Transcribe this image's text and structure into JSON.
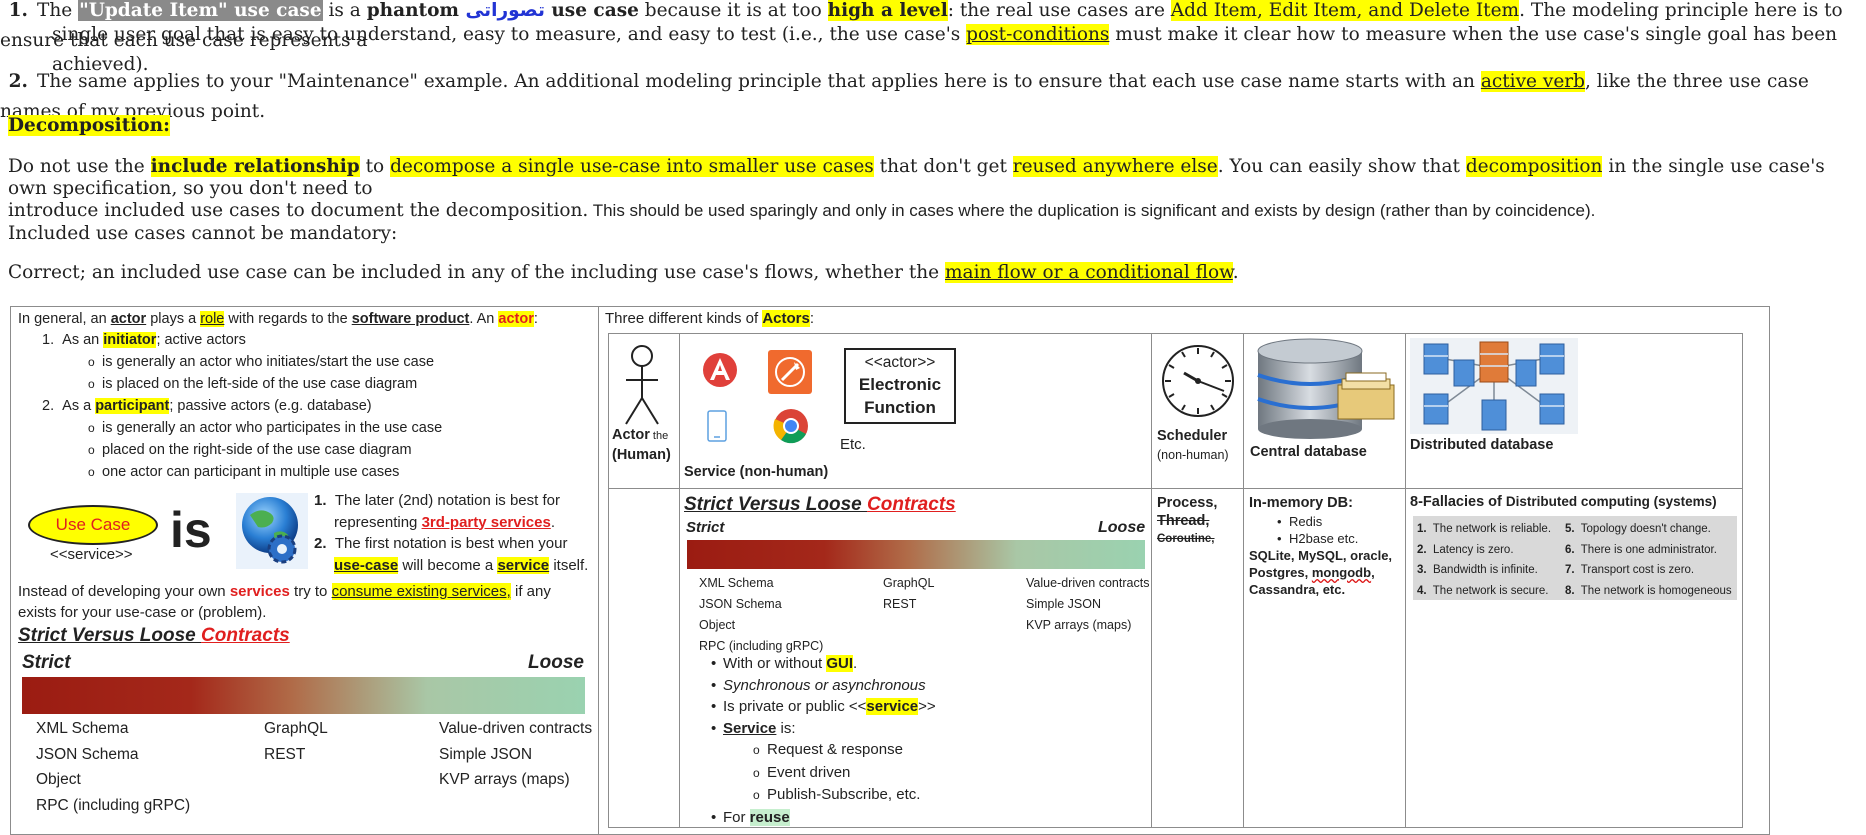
{
  "top": {
    "p1": {
      "num": "1.",
      "a": "The ",
      "b": "\"Update Item\" use case",
      "c": " is a ",
      "d": "phantom",
      "e": " تصوراتی ",
      "f": "use case",
      "g": " because it is at too ",
      "h": "high a level",
      "i": ": the real use cases are ",
      "j": "Add Item, Edit Item, and Delete Item",
      "k": ". The modeling principle here is to ensure that each use case represents a",
      "l": "single user goal that is easy to understand, easy to measure, and easy to test (i.e., the use case's ",
      "m": "post-conditions",
      "n": " must make it clear how to measure when the use case's single goal has been achieved)."
    },
    "p2": {
      "num": "2.",
      "a": "The same applies to your \"Maintenance\" example. An additional modeling principle that applies here is to ensure that each use case name starts with an ",
      "b": "active verb",
      "c": ", like the three use case names of my previous point."
    },
    "decomp_heading": "Decomposition:",
    "p3": {
      "a": "Do not use the ",
      "b": "include relationship",
      "c": " to ",
      "d": "decompose a single use-case into smaller use cases",
      "e": " that don't get ",
      "f": "reused anywhere else",
      "g": ". You can easily show that ",
      "h": "decomposition",
      "i": " in the single use case's own specification, so you don't need to",
      "j": "introduce included use cases to document the decomposition.",
      "k": " This should be used sparingly and only in cases where the duplication is significant and exists by design (rather than by coincidence)."
    },
    "p4": "Included use cases cannot be mandatory:",
    "p5": {
      "a": "Correct; an included use case can be included in any of the including use case's flows, whether the ",
      "b": "main flow or a conditional flow",
      "c": "."
    }
  },
  "left": {
    "intro": {
      "a": "In general, an ",
      "b": "actor",
      "c": " plays a ",
      "d": "role",
      "e": " with regards to the ",
      "f": "software product",
      "g": ". An ",
      "h": "actor",
      "i": ":"
    },
    "l1": {
      "num": "1.",
      "a": "As an ",
      "b": "initiator",
      "c": "; active actors"
    },
    "l1a": "is generally an actor who initiates/start the use case",
    "l1b": "is placed on the left-side of the use case diagram",
    "l2": {
      "num": "2.",
      "a": "As a ",
      "b": "participant",
      "c": "; passive actors (e.g. database)"
    },
    "l2a": "is generally an actor who participates in the use case",
    "l2b": "placed on the right-side of the use case diagram",
    "l2c": "one actor can participant in multiple use cases",
    "usecase_label": "Use Case",
    "service_label": "<<service>>",
    "is_label": "is",
    "n1": {
      "num": "1.",
      "a": "The later (2nd) notation is best for",
      "b": "representing ",
      "c": "3rd-party services",
      "d": "."
    },
    "n2": {
      "num": "2.",
      "a": "The first notation is best when your",
      "b": "use-case",
      "c": " will become a ",
      "d": "service",
      "e": " itself."
    },
    "instead": {
      "a": "Instead of developing your own ",
      "b": "services",
      "c": " try to ",
      "d": "consume existing services,",
      "e": " if any",
      "f": "exists for your use-case or (problem)."
    },
    "svl": {
      "a": "Strict Versus Loose ",
      "b": "Contracts"
    },
    "strict": "Strict",
    "loose": "Loose",
    "col1": [
      "XML Schema",
      "JSON Schema",
      "Object",
      "RPC (including gRPC)"
    ],
    "col2": [
      "GraphQL",
      "REST"
    ],
    "col3": [
      "Value-driven contracts",
      "Simple JSON",
      "KVP arrays (maps)"
    ]
  },
  "right": {
    "heading": {
      "a": "Three different kinds of ",
      "b": "Actors",
      "c": ":"
    },
    "actor_human": {
      "a": "Actor",
      "b": " the",
      "c": "(Human)"
    },
    "electronic": {
      "a": "<<actor>>",
      "b": "Electronic",
      "c": "Function"
    },
    "etc": "Etc.",
    "service_nonhuman": "Service (non-human)",
    "scheduler": {
      "a": "Scheduler",
      "b": "(non-human)"
    },
    "central_db": "Central database",
    "distributed_db": "Distributed database",
    "svl": {
      "a": "Strict Versus Loose ",
      "b": "Contracts"
    },
    "strict": "Strict",
    "loose": "Loose",
    "col1": [
      "XML Schema",
      "JSON Schema",
      "Object",
      "RPC (including gRPC)"
    ],
    "col2": [
      "GraphQL",
      "REST"
    ],
    "col3": [
      "Value-driven contracts",
      "Simple JSON",
      "KVP arrays (maps)"
    ],
    "b1": {
      "a": "With or without ",
      "b": "GUI",
      "c": "."
    },
    "b2": "Synchronous or asynchronous",
    "b3": {
      "a": "Is private or public <<",
      "b": "service",
      "c": ">>"
    },
    "b4": {
      "a": "Service",
      "b": " is:"
    },
    "b4a": "Request & response",
    "b4b": "Event driven",
    "b4c": "Publish-Subscribe, etc.",
    "b5": {
      "a": "For ",
      "b": "reuse"
    },
    "process": {
      "a": "Process,",
      "b": "Thread,",
      "c": "Coroutine,"
    },
    "inmem": {
      "h": "In-memory DB:",
      "a": "Redis",
      "b": "H2base etc.",
      "c": "SQLite, MySQL, oracle,",
      "d": "Postgres, ",
      "e": "mongodb",
      "f": ",",
      "g": "Cassandra, etc."
    },
    "fallacies": {
      "heading_a": "8-Fallacies of ",
      "heading_b": "Distributed computing (systems)",
      "left": [
        "The network is reliable.",
        "Latency is zero.",
        "Bandwidth is infinite.",
        "The network is secure."
      ],
      "right": [
        "Topology doesn't change.",
        "There is one administrator.",
        "Transport cost is zero.",
        "The network is homogeneous"
      ]
    }
  }
}
